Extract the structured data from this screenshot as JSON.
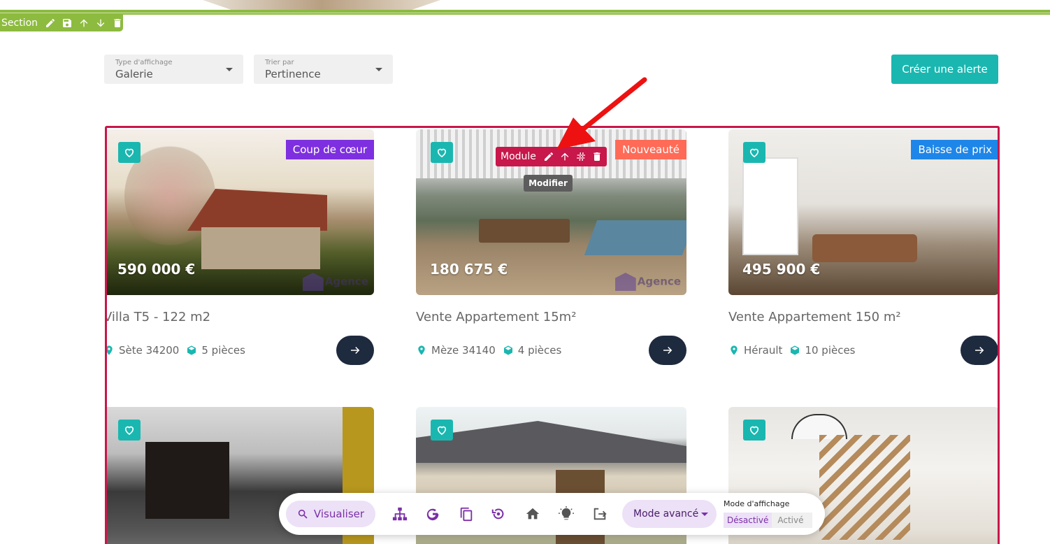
{
  "section_toolbar": {
    "label": "Section",
    "icons": [
      "pencil-icon",
      "save-icon",
      "arrow-up-icon",
      "arrow-down-icon",
      "trash-icon"
    ]
  },
  "filters": {
    "display_type": {
      "label": "Type d'affichage",
      "value": "Galerie"
    },
    "sort_by": {
      "label": "Trier par",
      "value": "Pertinence"
    }
  },
  "create_alert_label": "Créer une alerte",
  "module_toolbar": {
    "label": "Module",
    "tooltip": "Modifier",
    "icons": [
      "pencil-icon",
      "arrow-up-icon",
      "hash-icon",
      "trash-icon"
    ]
  },
  "listings": [
    {
      "title": "Villa T5 - 122 m2",
      "price": "590 000 €",
      "badge": "Coup de cœur",
      "badge_color": "#7e2fe0",
      "location": "Sète 34200",
      "rooms": "5 pièces",
      "watermark": "Agence"
    },
    {
      "title": "Vente Appartement 15m²",
      "price": "180 675 €",
      "badge": "Nouveauté",
      "badge_color": "#ff6b57",
      "location": "Mèze 34140",
      "rooms": "4 pièces",
      "watermark": "Agence"
    },
    {
      "title": "Vente Appartement 150 m²",
      "price": "495 900 €",
      "badge": "Baisse de prix",
      "badge_color": "#1e86e8",
      "location": "Hérault",
      "rooms": "10 pièces",
      "watermark": ""
    }
  ],
  "bottom_toolbar": {
    "visualize_label": "Visualiser",
    "icons": [
      "sitemap-icon",
      "google-icon",
      "copy-icon",
      "history-icon",
      "home-icon",
      "lightbulb-icon",
      "exit-icon"
    ],
    "mode_label": "Mode avancé",
    "display_mode": {
      "label": "Mode d'affichage",
      "off": "Désactivé",
      "on": "Activé"
    }
  },
  "colors": {
    "accent": "#1ab7b0",
    "module": "#c8174a",
    "section": "#8dbb3f",
    "purple": "#7b2fa8"
  }
}
